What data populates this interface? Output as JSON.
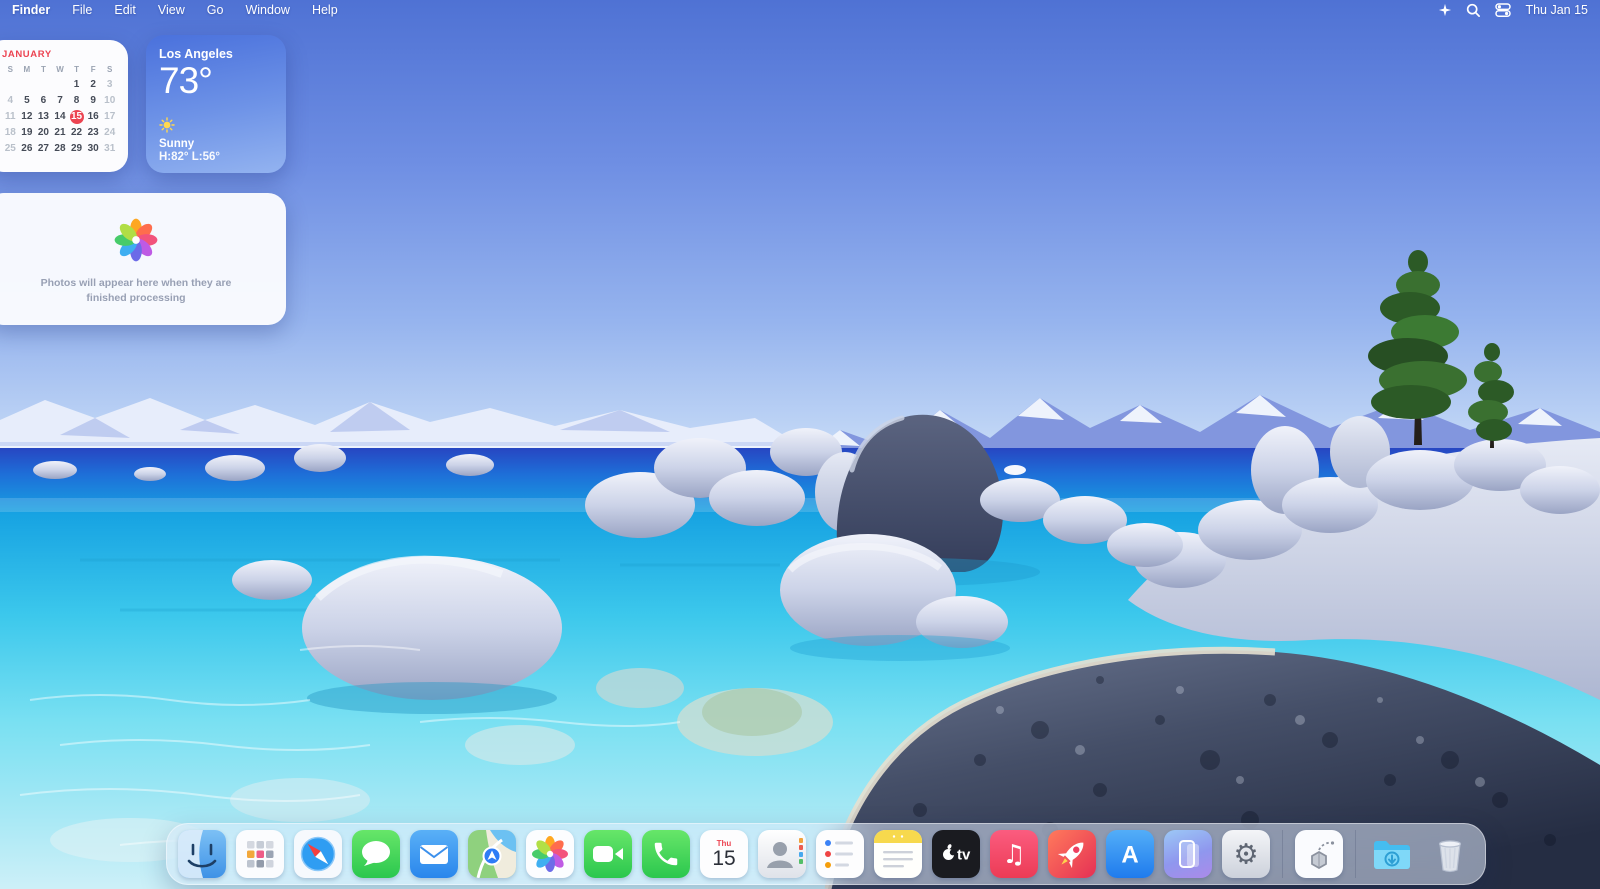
{
  "menu_bar": {
    "menus": [
      "Finder",
      "File",
      "Edit",
      "View",
      "Go",
      "Window",
      "Help"
    ],
    "status": {
      "icons": [
        "apple-intelligence-icon",
        "spotlight-icon",
        "control-center-icon"
      ],
      "clock": "Thu Jan 15"
    }
  },
  "widgets": {
    "calendar": {
      "month": "JANUARY",
      "accent_color": "#ec4452",
      "day_headers": [
        "S",
        "M",
        "T",
        "W",
        "T",
        "F",
        "S"
      ],
      "weeks": [
        [
          "",
          "",
          "",
          "",
          "1",
          "2",
          "3"
        ],
        [
          "4",
          "5",
          "6",
          "7",
          "8",
          "9",
          "10"
        ],
        [
          "11",
          "12",
          "13",
          "14",
          "15",
          "16",
          "17"
        ],
        [
          "18",
          "19",
          "20",
          "21",
          "22",
          "23",
          "24"
        ],
        [
          "25",
          "26",
          "27",
          "28",
          "29",
          "30",
          "31"
        ]
      ],
      "selected_day": "15"
    },
    "weather": {
      "city": "Los Angeles",
      "temperature": "73°",
      "condition": "Sunny",
      "high_low": "H:82° L:56°"
    },
    "photos": {
      "message": "Photos will appear here when they are finished processing"
    }
  },
  "dock": {
    "items": [
      "finder",
      "launchpad",
      "safari",
      "messages",
      "mail",
      "maps",
      "photos",
      "facetime",
      "phone",
      "calendar",
      "contacts",
      "reminders",
      "notes",
      "tv",
      "music",
      "games",
      "app-store",
      "iphone-mirroring",
      "settings",
      "separator",
      "recent-app",
      "separator",
      "downloads",
      "trash"
    ],
    "calendar_icon": {
      "weekday": "Thu",
      "day": "15"
    }
  }
}
